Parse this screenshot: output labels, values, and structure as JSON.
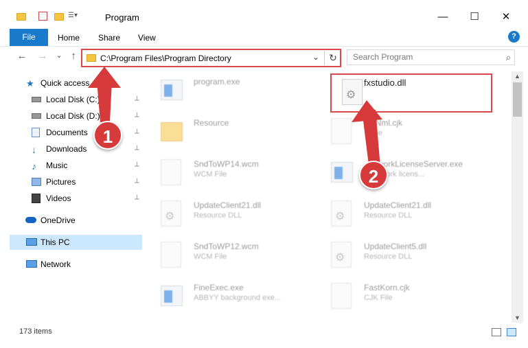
{
  "window": {
    "title": "Program",
    "minimize": "—",
    "maximize": "☐",
    "close": "✕"
  },
  "ribbon": {
    "file": "File",
    "tabs": [
      "Home",
      "Share",
      "View"
    ],
    "help": "?"
  },
  "nav": {
    "back": "←",
    "forward": "→",
    "recent": "⌄",
    "up": "↑"
  },
  "address": {
    "path": "C:\\Program Files\\Program Directory",
    "dropdown": "⌄",
    "refresh": "↻"
  },
  "search": {
    "placeholder": "Search Program",
    "icon": "⌕"
  },
  "sidebar": {
    "items": [
      {
        "label": "Quick access",
        "icon": "star-icon"
      },
      {
        "label": "Local Disk (C:)",
        "icon": "drive-icon"
      },
      {
        "label": "Local Disk (D:)",
        "icon": "drive-icon"
      },
      {
        "label": "Documents",
        "icon": "documents-icon"
      },
      {
        "label": "Downloads",
        "icon": "download-icon"
      },
      {
        "label": "Music",
        "icon": "music-icon"
      },
      {
        "label": "Pictures",
        "icon": "pictures-icon"
      },
      {
        "label": "Videos",
        "icon": "videos-icon"
      },
      {
        "label": "OneDrive",
        "icon": "cloud-icon"
      },
      {
        "label": "This PC",
        "icon": "computer-icon"
      },
      {
        "label": "Network",
        "icon": "network-icon"
      }
    ],
    "pin": "📌"
  },
  "files": [
    {
      "name": "program.exe",
      "sub": ""
    },
    {
      "name": "fxstudio.dll",
      "sub": ""
    },
    {
      "name": "Resource",
      "sub": ""
    },
    {
      "name": "...dNml.cjk",
      "sub": "...File"
    },
    {
      "name": "SndToWP14.wcm",
      "sub": "WCM File"
    },
    {
      "name": "...etworkLicenseServer.exe",
      "sub": "...network licens..."
    },
    {
      "name": "UpdateClient21.dll",
      "sub": "Resource DLL"
    },
    {
      "name": "UpdateClient21.dll",
      "sub": "Resource DLL"
    },
    {
      "name": "SndToWP12.wcm",
      "sub": "WCM File"
    },
    {
      "name": "UpdateClient5.dll",
      "sub": "Resource DLL"
    },
    {
      "name": "FineExec.exe",
      "sub": "ABBYY background exe..."
    },
    {
      "name": "FastKorn.cjk",
      "sub": "CJK File"
    }
  ],
  "status": {
    "items": "173 items"
  },
  "annotations": {
    "badge1": "1",
    "badge2": "2"
  },
  "colors": {
    "accent": "#1979ca",
    "annotation": "#d63a3a",
    "selection": "#cce8ff"
  }
}
